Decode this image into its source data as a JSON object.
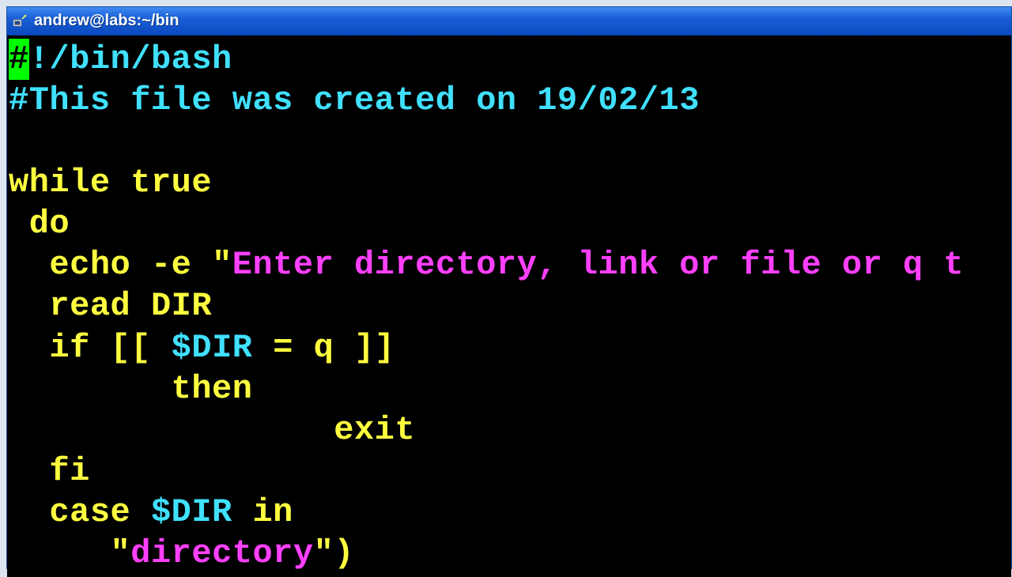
{
  "window": {
    "title": "andrew@labs:~/bin"
  },
  "code": {
    "cursor_char": "#",
    "shebang": "!/bin/bash",
    "comment2": "#This file was created on 19/02/13",
    "l_while": "while",
    "l_true": " true",
    "l_do": " do",
    "l_echo": "  echo",
    "l_echo_flag": " -e ",
    "l_echo_q": "\"",
    "l_echo_str": "Enter directory, link or file or q t",
    "l_read": "  read",
    "l_read_var": " DIR",
    "l_if": "  if",
    "l_if_open": " [[ ",
    "l_if_var": "$DIR",
    "l_if_mid": " = q ",
    "l_if_close": "]]",
    "l_then": "        then",
    "l_exit": "                exit",
    "l_fi": "  fi",
    "l_case": "  case ",
    "l_case_var": "$DIR",
    "l_case_in": " in",
    "l_case_arm_pre": "     ",
    "l_case_arm_q": "\"",
    "l_case_arm_str": "directory",
    "l_case_arm_close": ")"
  }
}
